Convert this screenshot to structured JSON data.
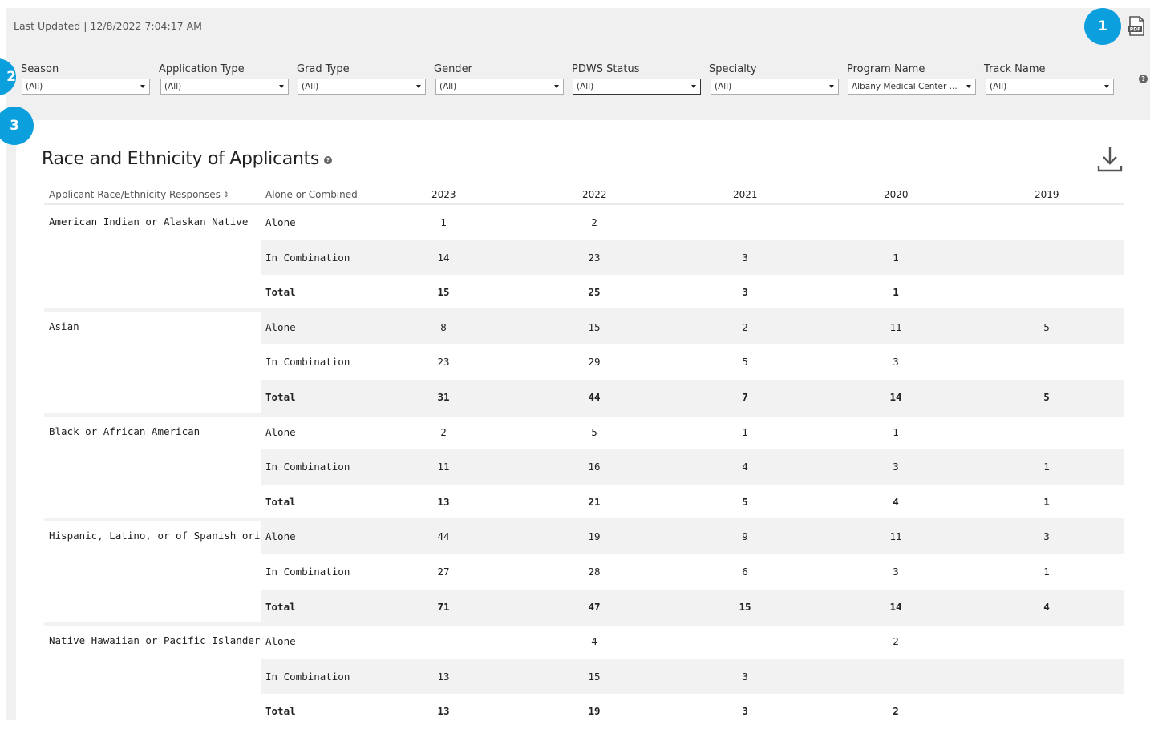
{
  "header": {
    "last_updated": "Last Updated | 12/8/2022 7:04:17 AM",
    "badges": [
      "1",
      "2",
      "3"
    ],
    "icons": {
      "pdf": "pdf-icon",
      "help": "help-icon",
      "download": "download-icon"
    }
  },
  "filters": [
    {
      "label": "Season",
      "value": "(All)"
    },
    {
      "label": "Application Type",
      "value": "(All)"
    },
    {
      "label": "Grad Type",
      "value": "(All)"
    },
    {
      "label": "Gender",
      "value": "(All)"
    },
    {
      "label": "PDWS Status",
      "value": "(All)"
    },
    {
      "label": "Specialty",
      "value": "(All)"
    },
    {
      "label": "Program Name",
      "value": "Albany Medical Center ..."
    },
    {
      "label": "Track Name",
      "value": "(All)"
    }
  ],
  "section": {
    "title": "Race and Ethnicity of Applicants"
  },
  "table": {
    "col_race": "Applicant Race/Ethnicity Responses",
    "col_type": "Alone or Combined",
    "years": [
      "2023",
      "2022",
      "2021",
      "2020",
      "2019"
    ],
    "groups": [
      {
        "race": "American Indian or Alaskan Native",
        "rows": [
          {
            "type": "Alone",
            "values": [
              "1",
              "2",
              "",
              "",
              ""
            ]
          },
          {
            "type": "In Combination",
            "values": [
              "14",
              "23",
              "3",
              "1",
              ""
            ]
          },
          {
            "type": "Total",
            "values": [
              "15",
              "25",
              "3",
              "1",
              ""
            ]
          }
        ]
      },
      {
        "race": "Asian",
        "rows": [
          {
            "type": "Alone",
            "values": [
              "8",
              "15",
              "2",
              "11",
              "5"
            ]
          },
          {
            "type": "In Combination",
            "values": [
              "23",
              "29",
              "5",
              "3",
              ""
            ]
          },
          {
            "type": "Total",
            "values": [
              "31",
              "44",
              "7",
              "14",
              "5"
            ]
          }
        ]
      },
      {
        "race": "Black or African American",
        "rows": [
          {
            "type": "Alone",
            "values": [
              "2",
              "5",
              "1",
              "1",
              ""
            ]
          },
          {
            "type": "In Combination",
            "values": [
              "11",
              "16",
              "4",
              "3",
              "1"
            ]
          },
          {
            "type": "Total",
            "values": [
              "13",
              "21",
              "5",
              "4",
              "1"
            ]
          }
        ]
      },
      {
        "race": "Hispanic, Latino, or of Spanish origin",
        "rows": [
          {
            "type": "Alone",
            "values": [
              "44",
              "19",
              "9",
              "11",
              "3"
            ]
          },
          {
            "type": "In Combination",
            "values": [
              "27",
              "28",
              "6",
              "3",
              "1"
            ]
          },
          {
            "type": "Total",
            "values": [
              "71",
              "47",
              "15",
              "14",
              "4"
            ]
          }
        ]
      },
      {
        "race": "Native Hawaiian or Pacific Islander",
        "rows": [
          {
            "type": "Alone",
            "values": [
              "",
              "4",
              "",
              "2",
              ""
            ]
          },
          {
            "type": "In Combination",
            "values": [
              "13",
              "15",
              "3",
              "",
              ""
            ]
          },
          {
            "type": "Total",
            "values": [
              "13",
              "19",
              "3",
              "2",
              ""
            ]
          }
        ]
      }
    ]
  },
  "colors": {
    "accent": "#0b9fde",
    "panel": "#f0f0f0",
    "row_shade": "#f2f2f2"
  }
}
